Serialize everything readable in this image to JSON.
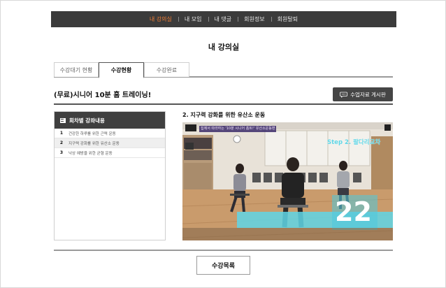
{
  "nav": {
    "items": [
      {
        "label": "내 강의실",
        "active": true
      },
      {
        "label": "내 모임",
        "active": false
      },
      {
        "label": "내 댓글",
        "active": false
      },
      {
        "label": "회원정보",
        "active": false
      },
      {
        "label": "회원탈퇴",
        "active": false
      }
    ]
  },
  "page_title": "내 강의실",
  "tabs": [
    {
      "label": "수강대기 현황"
    },
    {
      "label": "수강현황"
    },
    {
      "label": "수강완료"
    }
  ],
  "course": {
    "title": "(무료)시니어 10분 홈 트레이닝!",
    "board_button": "수업자료 게시판"
  },
  "lessons": {
    "header": "회차별 강좌내용",
    "items": [
      {
        "num": "1",
        "title": "건강한 하루를 위한 근력 운동"
      },
      {
        "num": "2",
        "title": "지구력 강화를 위한 유산소 운동"
      },
      {
        "num": "3",
        "title": "낙상 예방을 위한 균형 운동"
      }
    ],
    "selected_index": 1
  },
  "current_lesson_title": "2. 지구력 강화를 위한 유산소 운동",
  "video": {
    "caption": "집에서 따라하는 '10분 시니어 홈트!' 유산소운동편",
    "step_label": "Step 2. 팔다리교차",
    "counter": "22"
  },
  "footer": {
    "list_button": "수강목록"
  },
  "colors": {
    "nav_bg": "#3b3b3b",
    "nav_active": "#f07c33",
    "panel_head": "#3f3f3f",
    "overlay_cyan": "#5fd6e6"
  }
}
